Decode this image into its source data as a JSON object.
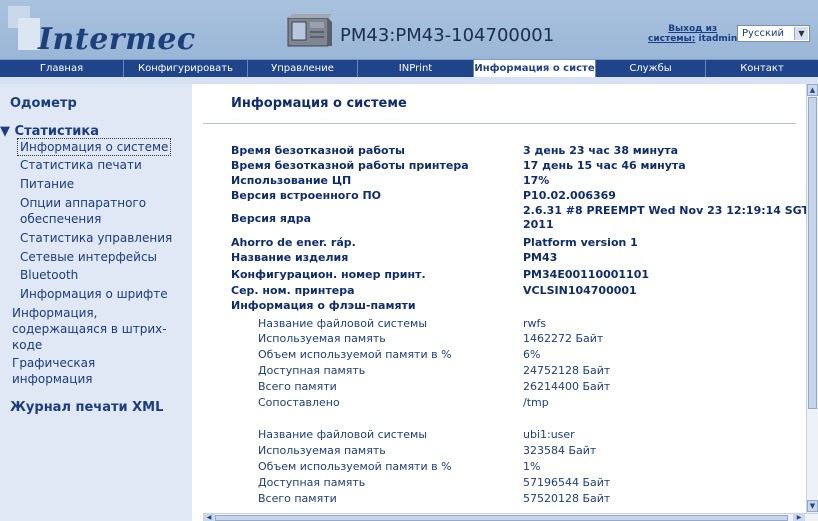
{
  "header": {
    "logo_text": "Intermec",
    "printer_name": "PM43:PM43-104700001",
    "logout_line1": "Выход из",
    "logout_line2": "системы:",
    "logout_user": "itadmin",
    "language": "Русский"
  },
  "nav": {
    "items": [
      {
        "label": "Главная"
      },
      {
        "label": "Конфигурировать"
      },
      {
        "label": "Управление"
      },
      {
        "label": "INPrint"
      },
      {
        "label": "Информация о систе"
      },
      {
        "label": "Службы"
      },
      {
        "label": "Контакт"
      }
    ],
    "active_index": 4
  },
  "sidebar": {
    "odometer": "Одометр",
    "statistics": "▼ Статистика",
    "items": [
      {
        "label": "Информация о системе"
      },
      {
        "label": "Статистика печати"
      },
      {
        "label": "Питание"
      },
      {
        "label": "Опции аппаратного"
      },
      {
        "label": "обеспечения"
      },
      {
        "label": "Статистика управления"
      },
      {
        "label": "Сетевые интерфейсы"
      },
      {
        "label": "Bluetooth"
      },
      {
        "label": "Информация о шрифте"
      },
      {
        "label": "Информация,"
      },
      {
        "label": "содержащаяся в штрих-"
      },
      {
        "label": "коде"
      },
      {
        "label": "Графическая"
      },
      {
        "label": "информация"
      }
    ],
    "xml_log": "Журнал печати XML"
  },
  "main": {
    "title": "Информация о системе",
    "info": [
      {
        "label": "Время безотказной работы",
        "value": "3 день 23 час 38 минута"
      },
      {
        "label": "Время безотказной работы принтера",
        "value": "17 день 15 час 46 минута"
      },
      {
        "label": "Использование ЦП",
        "value": "17%"
      },
      {
        "label": "Версия встроенного ПО",
        "value": "P10.02.006369"
      },
      {
        "label": "Версия ядра",
        "value": "2.6.31 #8 PREEMPT Wed Nov 23 12:19:14 SGT",
        "value2": "2011"
      },
      {
        "label": "Ahorro de ener. ráp.",
        "value": "Platform version 1"
      },
      {
        "label": "Название изделия",
        "value": "PM43"
      },
      {
        "label": "Конфигурацион. номер принт.",
        "value": "PM34E00110001101"
      },
      {
        "label": "Сер. ном. принтера",
        "value": "VCLSIN104700001"
      }
    ],
    "flash_header": "Информация о флэш-памяти",
    "fs1": [
      {
        "label": "Название файловой системы",
        "value": "rwfs"
      },
      {
        "label": "Используемая память",
        "value": "1462272 Байт"
      },
      {
        "label": "Объем используемой памяти в %",
        "value": "6%"
      },
      {
        "label": "Доступная память",
        "value": "24752128 Байт"
      },
      {
        "label": "Всего памяти",
        "value": "26214400 Байт"
      },
      {
        "label": "Сопоставлено",
        "value": "/tmp"
      }
    ],
    "fs2": [
      {
        "label": "Название файловой системы",
        "value": "ubi1:user"
      },
      {
        "label": "Используемая память",
        "value": "323584 Байт"
      },
      {
        "label": "Объем используемой памяти в %",
        "value": "1%"
      },
      {
        "label": "Доступная память",
        "value": "57196544 Байт"
      },
      {
        "label": "Всего памяти",
        "value": "57520128 Байт"
      }
    ]
  },
  "colors": {
    "nav_bg": "#1f4489",
    "sidebar_bg": "#dfe8f4",
    "text_dark_blue": "#0f2d6b",
    "header_bg": "#a9c2de"
  }
}
